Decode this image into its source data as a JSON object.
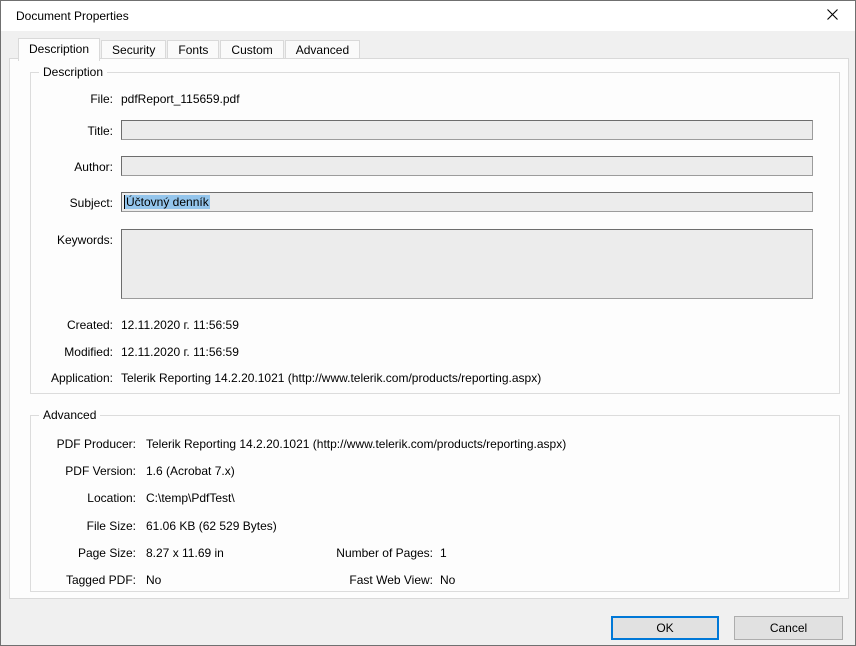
{
  "window": {
    "title": "Document Properties"
  },
  "icons": {
    "close": "✕"
  },
  "tabs": [
    {
      "label": "Description",
      "active": true
    },
    {
      "label": "Security",
      "active": false
    },
    {
      "label": "Fonts",
      "active": false
    },
    {
      "label": "Custom",
      "active": false
    },
    {
      "label": "Advanced",
      "active": false
    }
  ],
  "description": {
    "legend": "Description",
    "file": {
      "label": "File:",
      "value": "pdfReport_115659.pdf"
    },
    "title": {
      "label": "Title:",
      "value": ""
    },
    "author": {
      "label": "Author:",
      "value": ""
    },
    "subject": {
      "label": "Subject:",
      "value": "Účtovný denník",
      "selected": true
    },
    "keywords": {
      "label": "Keywords:",
      "value": ""
    },
    "created": {
      "label": "Created:",
      "value": "12.11.2020 г. 11:56:59"
    },
    "modified": {
      "label": "Modified:",
      "value": "12.11.2020 г. 11:56:59"
    },
    "application": {
      "label": "Application:",
      "value": "Telerik Reporting 14.2.20.1021 (http://www.telerik.com/products/reporting.aspx)"
    }
  },
  "advanced": {
    "legend": "Advanced",
    "pdf_producer": {
      "label": "PDF Producer:",
      "value": "Telerik Reporting 14.2.20.1021 (http://www.telerik.com/products/reporting.aspx)"
    },
    "pdf_version": {
      "label": "PDF Version:",
      "value": "1.6 (Acrobat 7.x)"
    },
    "location": {
      "label": "Location:",
      "value": "C:\\temp\\PdfTest\\"
    },
    "file_size": {
      "label": "File Size:",
      "value": "61.06 KB (62 529 Bytes)"
    },
    "page_size": {
      "label": "Page Size:",
      "value": "8.27 x 11.69 in"
    },
    "number_of_pages": {
      "label": "Number of Pages:",
      "value": "1"
    },
    "tagged_pdf": {
      "label": "Tagged PDF:",
      "value": "No"
    },
    "fast_web_view": {
      "label": "Fast Web View:",
      "value": "No"
    }
  },
  "buttons": {
    "ok": "OK",
    "cancel": "Cancel"
  },
  "colors": {
    "accent": "#0078d7",
    "selection": "#94c5ec"
  }
}
